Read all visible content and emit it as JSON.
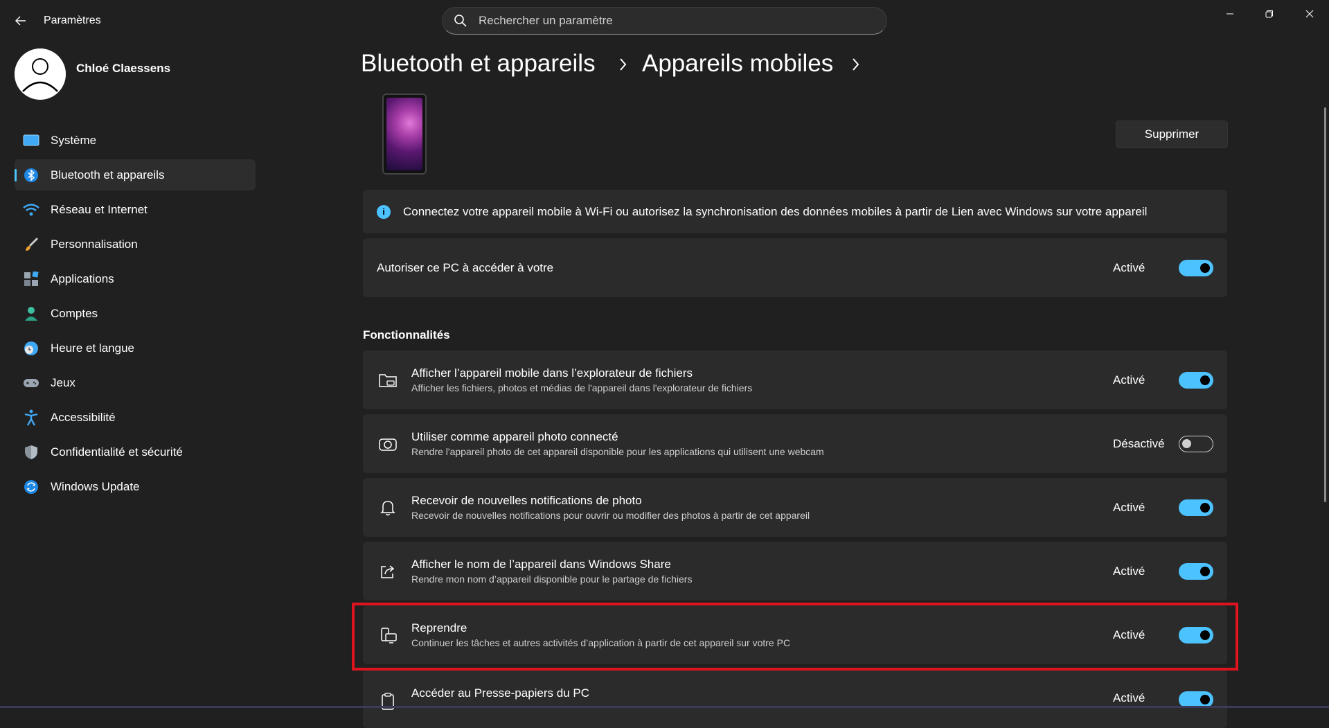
{
  "window": {
    "title": "Paramètres"
  },
  "search": {
    "placeholder": "Rechercher un paramètre"
  },
  "user": {
    "name": "Chloé Claessens"
  },
  "sidebar": {
    "items": [
      {
        "label": "Système",
        "icon": "monitor-icon",
        "active": false
      },
      {
        "label": "Bluetooth et appareils",
        "icon": "bluetooth-icon",
        "active": true
      },
      {
        "label": "Réseau et Internet",
        "icon": "wifi-icon",
        "active": false
      },
      {
        "label": "Personnalisation",
        "icon": "brush-icon",
        "active": false
      },
      {
        "label": "Applications",
        "icon": "apps-icon",
        "active": false
      },
      {
        "label": "Comptes",
        "icon": "person-icon",
        "active": false
      },
      {
        "label": "Heure et langue",
        "icon": "clock-globe-icon",
        "active": false
      },
      {
        "label": "Jeux",
        "icon": "gamepad-icon",
        "active": false
      },
      {
        "label": "Accessibilité",
        "icon": "accessibility-icon",
        "active": false
      },
      {
        "label": "Confidentialité et sécurité",
        "icon": "shield-icon",
        "active": false
      },
      {
        "label": "Windows Update",
        "icon": "update-icon",
        "active": false
      }
    ]
  },
  "breadcrumb": {
    "parent": "Bluetooth et appareils",
    "current": "Appareils mobiles"
  },
  "device": {
    "remove_label": "Supprimer"
  },
  "info": {
    "text": "Connectez votre appareil mobile à Wi-Fi ou autorisez la synchronisation des données mobiles à partir de Lien avec Windows sur votre appareil"
  },
  "access": {
    "title": "Autoriser ce PC à accéder à votre",
    "state": "Activé",
    "on": true
  },
  "features": {
    "section_title": "Fonctionnalités",
    "items": [
      {
        "title": "Afficher l’appareil mobile dans l’explorateur de fichiers",
        "subtitle": "Afficher les fichiers, photos et médias de l'appareil dans l'explorateur de fichiers",
        "state": "Activé",
        "on": true,
        "icon": "folder-icon"
      },
      {
        "title": "Utiliser comme appareil photo connecté",
        "subtitle": "Rendre l'appareil photo de cet appareil disponible pour les applications qui utilisent une webcam",
        "state": "Désactivé",
        "on": false,
        "icon": "camera-icon"
      },
      {
        "title": "Recevoir de nouvelles notifications de photo",
        "subtitle": "Recevoir de nouvelles notifications pour ouvrir ou modifier des photos à partir de cet appareil",
        "state": "Activé",
        "on": true,
        "icon": "bell-icon"
      },
      {
        "title": "Afficher le nom de l’appareil dans Windows Share",
        "subtitle": "Rendre mon nom d’appareil disponible pour le partage de fichiers",
        "state": "Activé",
        "on": true,
        "icon": "share-icon"
      },
      {
        "title": "Reprendre",
        "subtitle": "Continuer les tâches et autres activités d’application à partir de cet appareil sur votre PC",
        "state": "Activé",
        "on": true,
        "icon": "resume-devices-icon"
      },
      {
        "title": "Accéder au Presse-papiers du PC",
        "subtitle": "",
        "state": "Activé",
        "on": true,
        "icon": "clipboard-icon"
      }
    ]
  },
  "colors": {
    "accent": "#4cc2ff",
    "background": "#202020",
    "card": "#2b2b2b",
    "highlight": "#e0141e"
  }
}
